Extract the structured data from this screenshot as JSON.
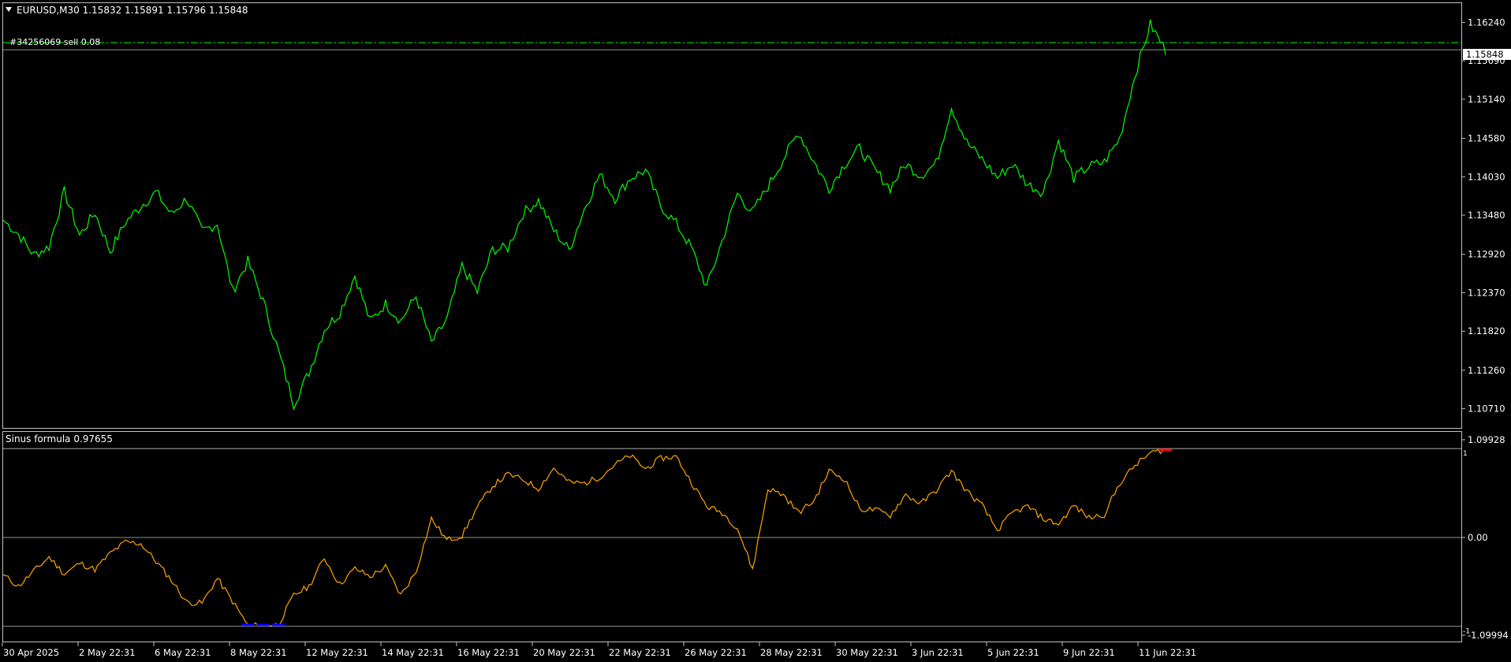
{
  "window": {
    "symbol_title": "EURUSD,M30  1.15832 1.15891 1.15796 1.15848",
    "collapse_icon": "triangle-down-icon"
  },
  "order_label": "#34256069 sell 0.08",
  "price_tag": "1.15848",
  "indicator_label": "Sinus formula 0.97655",
  "colors": {
    "price_line": "#00ff00",
    "indicator_line": "#ffa500",
    "indicator_low": "#0000ff",
    "indicator_high": "#ff0000",
    "order_line": "#00cc00",
    "frame": "#c0c0c0",
    "background": "#000000"
  },
  "chart_data": [
    {
      "type": "line",
      "series": [
        {
          "values": [
            1.1341,
            1.1321,
            1.1291,
            1.1303,
            1.1382,
            1.1319,
            1.1352,
            1.1296,
            1.1338,
            1.1361,
            1.1381,
            1.1349,
            1.1372,
            1.1325,
            1.1336,
            1.1239,
            1.1282,
            1.1225,
            1.1153,
            1.1078,
            1.1123,
            1.1185,
            1.1208,
            1.1262,
            1.1196,
            1.1221,
            1.1197,
            1.1232,
            1.1165,
            1.1198,
            1.1275,
            1.1238,
            1.1299,
            1.1301,
            1.1351,
            1.1369,
            1.1326,
            1.1298,
            1.1357,
            1.1406,
            1.1372,
            1.1401,
            1.1412,
            1.1361,
            1.1336,
            1.1301,
            1.1245,
            1.1311,
            1.1379,
            1.1352,
            1.1389,
            1.1428,
            1.1467,
            1.1425,
            1.1386,
            1.1421,
            1.1444,
            1.1412,
            1.1387,
            1.1421,
            1.1405,
            1.1422,
            1.1503,
            1.1452,
            1.1428,
            1.1402,
            1.1421,
            1.1392,
            1.1381,
            1.1455,
            1.1401,
            1.1418,
            1.1424,
            1.1458,
            1.1549,
            1.1621,
            1.1584
          ]
        }
      ],
      "ylim": [
        1.10435,
        1.16515
      ],
      "y_ticks": [
        "1.16240",
        "1.15690",
        "1.15140",
        "1.14580",
        "1.14030",
        "1.13480",
        "1.12920",
        "1.12370",
        "1.11820",
        "1.11260",
        "1.10710"
      ],
      "order_level": 1.1595,
      "current_level": 1.15848
    },
    {
      "type": "line",
      "series": [
        {
          "values": [
            -0.42,
            -0.55,
            -0.38,
            -0.22,
            -0.41,
            -0.29,
            -0.36,
            -0.18,
            -0.05,
            -0.07,
            -0.27,
            -0.48,
            -0.73,
            -0.74,
            -0.46,
            -0.72,
            -0.99,
            -0.99,
            -0.98,
            -0.65,
            -0.55,
            -0.23,
            -0.53,
            -0.35,
            -0.44,
            -0.33,
            -0.65,
            -0.38,
            0.21,
            -0.03,
            0.02,
            0.34,
            0.58,
            0.71,
            0.65,
            0.55,
            0.78,
            0.62,
            0.61,
            0.68,
            0.82,
            0.92,
            0.77,
            0.89,
            0.91,
            0.62,
            0.35,
            0.28,
            0.11,
            -0.36,
            0.55,
            0.48,
            0.28,
            0.41,
            0.75,
            0.66,
            0.32,
            0.31,
            0.25,
            0.48,
            0.38,
            0.53,
            0.75,
            0.52,
            0.36,
            0.08,
            0.28,
            0.35,
            0.21,
            0.15,
            0.36,
            0.22,
            0.26,
            0.61,
            0.81,
            0.95,
            0.99
          ]
        }
      ],
      "ylim": [
        -1.09994,
        1.09928
      ],
      "y_ticks": [
        "1.09928",
        "0.00",
        "-1.09994"
      ],
      "side_ticks": [
        "1",
        "-1"
      ],
      "levels": [
        1.0,
        0.0,
        -1.0
      ]
    }
  ],
  "x_axis": {
    "labels": [
      "30 Apr 2025",
      "2 May 22:31",
      "6 May 22:31",
      "8 May 22:31",
      "12 May 22:31",
      "14 May 22:31",
      "16 May 22:31",
      "20 May 22:31",
      "22 May 22:31",
      "26 May 22:31",
      "28 May 22:31",
      "30 May 22:31",
      "3 Jun 22:31",
      "5 Jun 22:31",
      "9 Jun 22:31",
      "11 Jun 22:31"
    ]
  }
}
